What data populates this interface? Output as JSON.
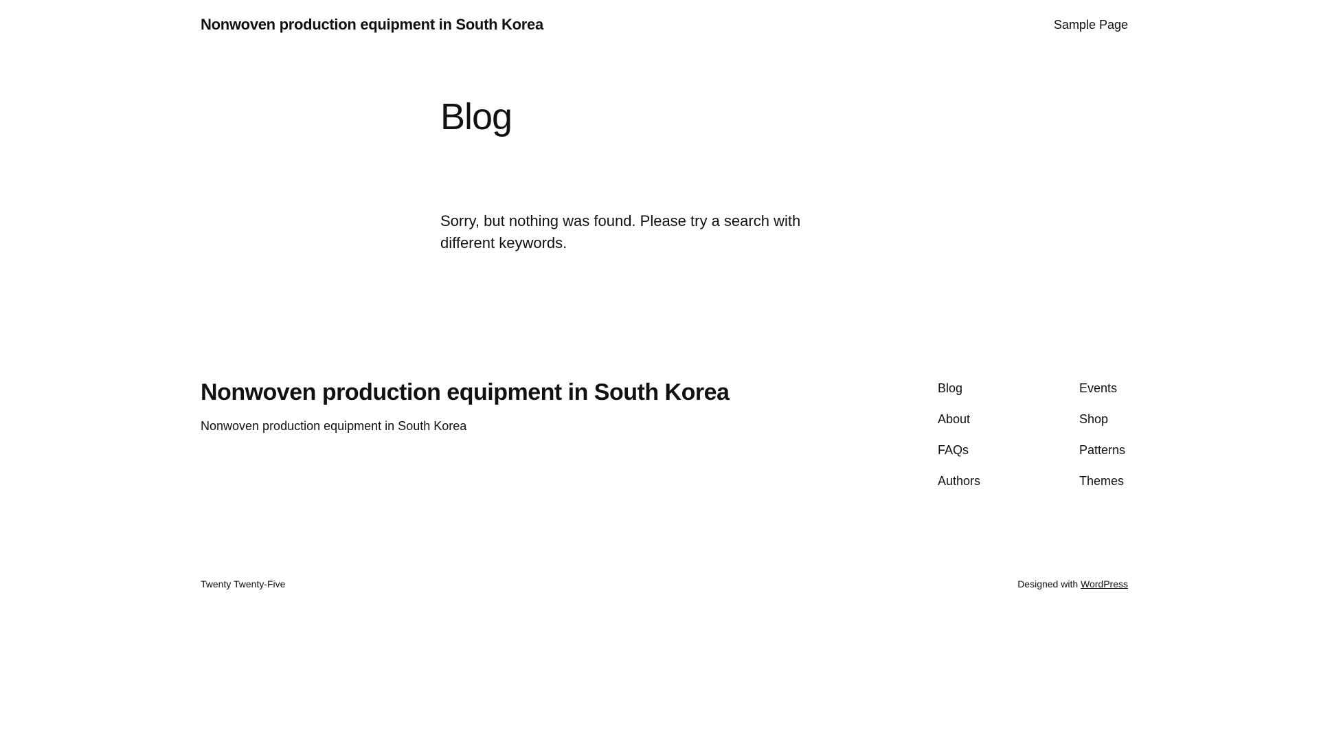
{
  "header": {
    "site_title": "Nonwoven production equipment in South Korea",
    "nav": [
      "Sample Page"
    ]
  },
  "main": {
    "title": "Blog",
    "message": "Sorry, but nothing was found. Please try a search with different keywords."
  },
  "footer": {
    "site_title": "Nonwoven production equipment in South Korea",
    "tagline": "Nonwoven production equipment in South Korea",
    "nav_col_1": [
      "Blog",
      "About",
      "FAQs",
      "Authors"
    ],
    "nav_col_2": [
      "Events",
      "Shop",
      "Patterns",
      "Themes"
    ],
    "theme_name": "Twenty Twenty-Five",
    "designed_with": "Designed with ",
    "wordpress_link": "WordPress"
  }
}
